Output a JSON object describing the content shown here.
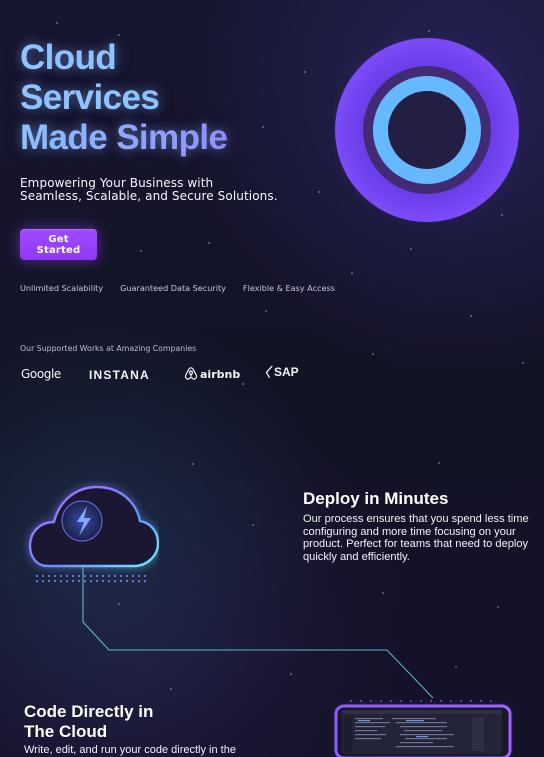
{
  "hero": {
    "title_lines": [
      "Cloud",
      "Services",
      "Made Simple"
    ],
    "subtitle_lines": [
      "Empowering Your Business with",
      "Seamless, Scalable, and Secure Solutions."
    ],
    "cta_label": "Get Started"
  },
  "features": [
    "Unlimited Scalability",
    "Guaranteed Data Security",
    "Flexible & Easy Access"
  ],
  "companies": {
    "label": "Our Supported Works at Amazing Companies",
    "logos": [
      {
        "text": "Google",
        "icon": "google-logo"
      },
      {
        "text": "INSTANA",
        "icon": "instana-logo"
      },
      {
        "text": "airbnb",
        "icon": "airbnb-logo"
      },
      {
        "text": "SAP",
        "icon": "sap-logo"
      }
    ]
  },
  "deploy": {
    "title": "Deploy in Minutes",
    "body_lines": [
      "Our process ensures that you spend less time",
      "configuring and more time focusing on your",
      "product. Perfect for teams that need to deploy",
      "quickly and efficiently."
    ]
  },
  "code": {
    "title_lines": [
      "Code Directly in",
      "The Cloud"
    ],
    "body": "Write, edit, and run your code directly in the"
  },
  "visuals": {
    "ring_outer": "#7d49f5",
    "ring_inner": "#68b4ff",
    "cloud_icon": "lightning-cloud-icon",
    "editor_icon": "code-editor-icon"
  }
}
